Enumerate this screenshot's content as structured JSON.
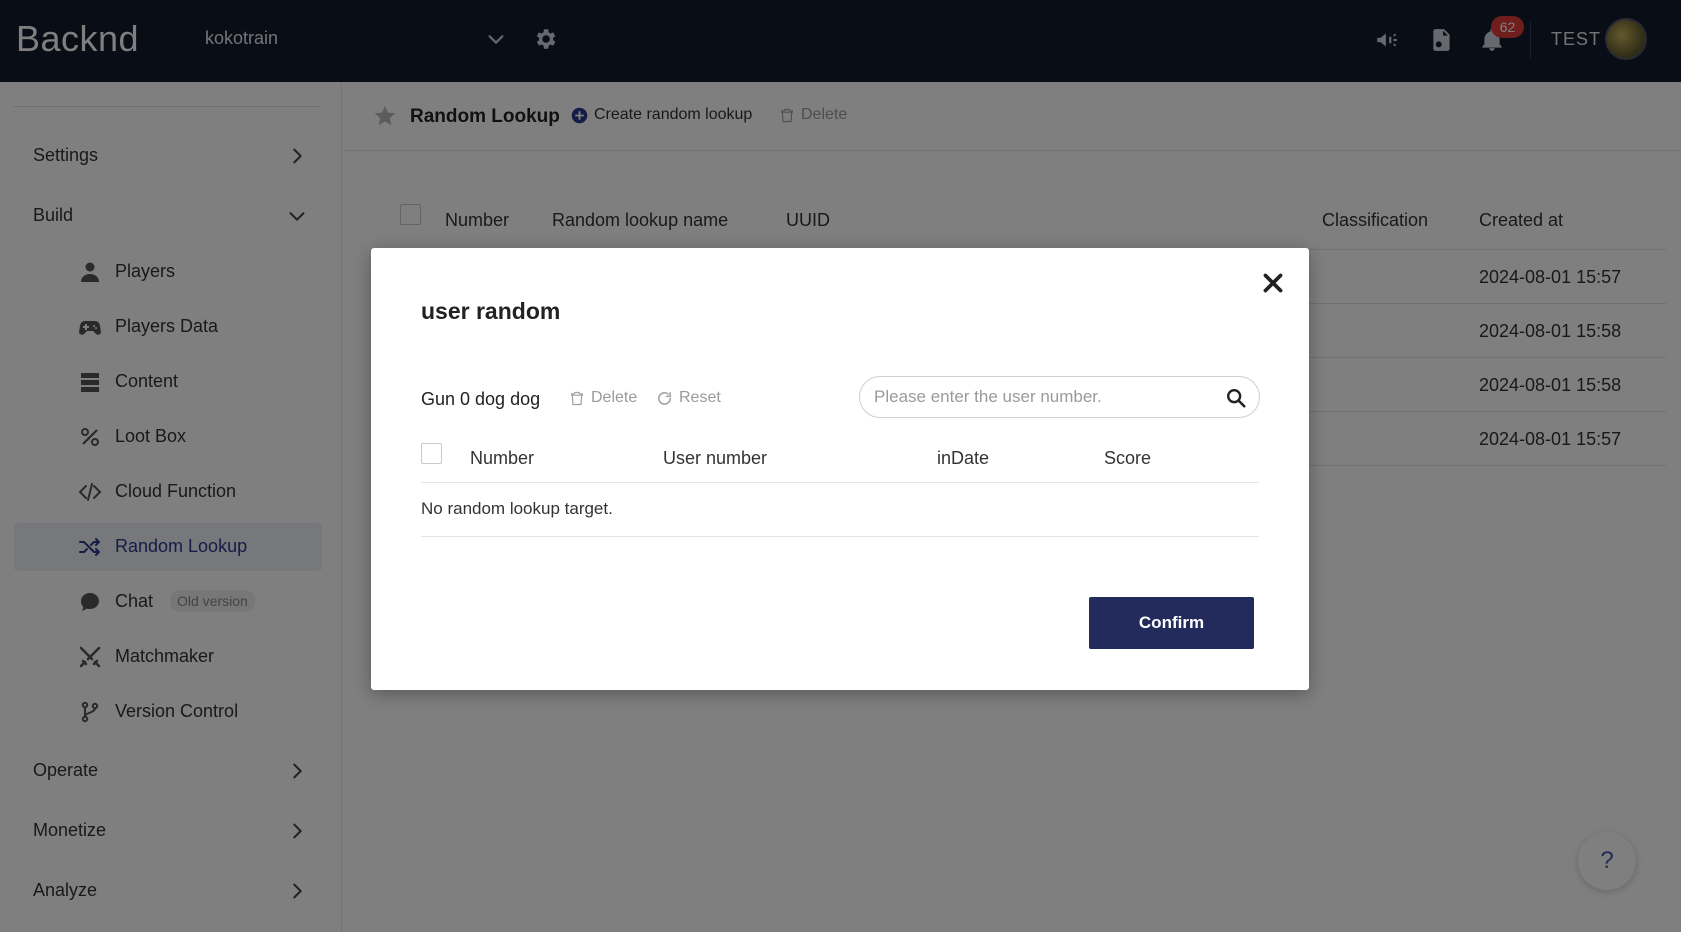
{
  "header": {
    "logo": "Backnd",
    "project": "kokotrain",
    "notification_count": "62",
    "user": "TEST"
  },
  "sidebar": {
    "groups": {
      "settings": "Settings",
      "build": "Build",
      "operate": "Operate",
      "monetize": "Monetize",
      "analyze": "Analyze"
    },
    "items": [
      {
        "label": "Players",
        "icon": "person-icon"
      },
      {
        "label": "Players Data",
        "icon": "gamepad-icon"
      },
      {
        "label": "Content",
        "icon": "database-icon"
      },
      {
        "label": "Loot Box",
        "icon": "percent-icon"
      },
      {
        "label": "Cloud Function",
        "icon": "code-icon"
      },
      {
        "label": "Random Lookup",
        "icon": "shuffle-icon",
        "active": true
      },
      {
        "label": "Chat",
        "icon": "chat-icon",
        "badge": "Old version"
      },
      {
        "label": "Matchmaker",
        "icon": "swords-icon"
      },
      {
        "label": "Version Control",
        "icon": "branch-icon"
      }
    ]
  },
  "page": {
    "title": "Random Lookup",
    "create_label": "Create random lookup",
    "delete_label": "Delete",
    "table": {
      "columns": [
        "Number",
        "Random lookup name",
        "UUID",
        "Classification",
        "Created at"
      ],
      "created_at": [
        "2024-08-01 15:57",
        "2024-08-01 15:58",
        "2024-08-01 15:58",
        "2024-08-01 15:57"
      ]
    },
    "help_label": "?"
  },
  "modal": {
    "title": "user random",
    "subtitle": "Gun 0 dog dog",
    "delete_label": "Delete",
    "reset_label": "Reset",
    "search_placeholder": "Please enter the user number.",
    "columns": [
      "Number",
      "User number",
      "inDate",
      "Score"
    ],
    "empty_text": "No random lookup target.",
    "confirm_label": "Confirm"
  },
  "colors": {
    "topbar": "#121a2c",
    "accent": "#232b5c",
    "badge": "#e03b3b",
    "active_bg": "#eef0f8"
  }
}
